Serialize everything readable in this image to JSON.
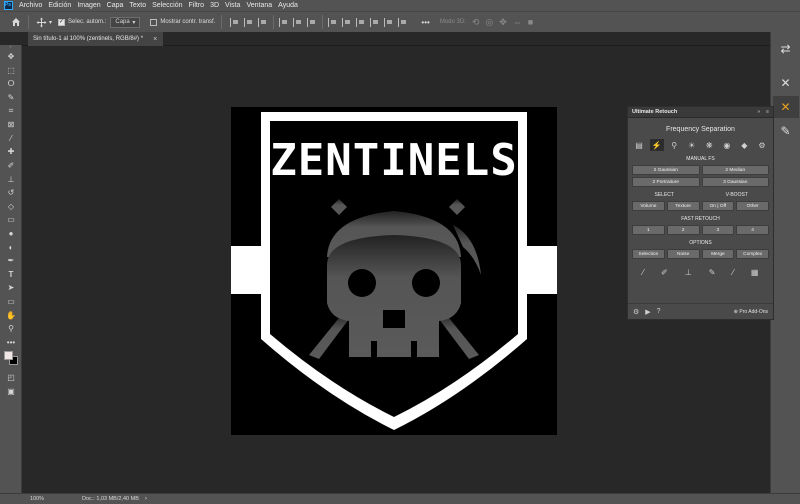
{
  "menu": [
    "Archivo",
    "Edición",
    "Imagen",
    "Capa",
    "Texto",
    "Selección",
    "Filtro",
    "3D",
    "Vista",
    "Ventana",
    "Ayuda"
  ],
  "app_logo": "Ps",
  "options_bar": {
    "auto_select_label": "Selec. autom.:",
    "auto_select_checked": true,
    "layer_select_value": "Capa",
    "transform_label": "Mostrar contr. transf.",
    "transform_checked": false,
    "more_icon": "•••",
    "mode3d_label": "Modo 3D:"
  },
  "document_tab": {
    "title": "Sin título-1 al 100% (zentinels, RGB/8#) *",
    "close": "×"
  },
  "artwork": {
    "logo_text": "ZENTINELS",
    "colors": {
      "background": "#000000",
      "shield": "#ffffff",
      "skull": "#5a5a5a"
    }
  },
  "toolbar": {
    "grip": "»",
    "tools": [
      "move-tool",
      "marquee-tool",
      "lasso-tool",
      "quick-select-tool",
      "crop-tool",
      "frame-tool",
      "eyedropper-tool",
      "healing-brush-tool",
      "brush-tool",
      "clone-stamp-tool",
      "history-brush-tool",
      "eraser-tool",
      "gradient-tool",
      "blur-tool",
      "dodge-tool",
      "pen-tool",
      "type-tool",
      "path-select-tool",
      "rectangle-tool",
      "hand-tool",
      "zoom-tool",
      "more-tools"
    ],
    "foreground_color": "#f0e6e6",
    "background_color": "#000000"
  },
  "right_strip": [
    "properties-icon",
    "tools-cross-icon",
    "ultimate-retouch-icon",
    "edit-icon"
  ],
  "panel": {
    "title": "Ultimate Retouch",
    "collapse": "»",
    "menu": "≡",
    "heading": "Frequency Separation",
    "manual_fs_title": "MANUAL FS",
    "manual_fs_buttons": [
      "2 Gaussian",
      "2 Median",
      "2 Portraiture",
      "3 Gaussian"
    ],
    "select_title": "SELECT",
    "vboost_title": "V-BOOST",
    "select_buttons": [
      "Volume",
      "Texture",
      "On | Off",
      "Other"
    ],
    "fast_retouch_title": "FAST RETOUCH",
    "fast_retouch_buttons": [
      "1",
      "2",
      "3",
      "4"
    ],
    "options_title": "OPTIONS",
    "options_buttons": [
      "Selection",
      "Noise",
      "Merge",
      "Complex"
    ],
    "pro_addons": "⊕ Pro Add-Ons",
    "help": "?"
  },
  "status": {
    "zoom": "100%",
    "doc": "Doc.: 1,03 MB/2,40 MB",
    "arrow": "›"
  }
}
